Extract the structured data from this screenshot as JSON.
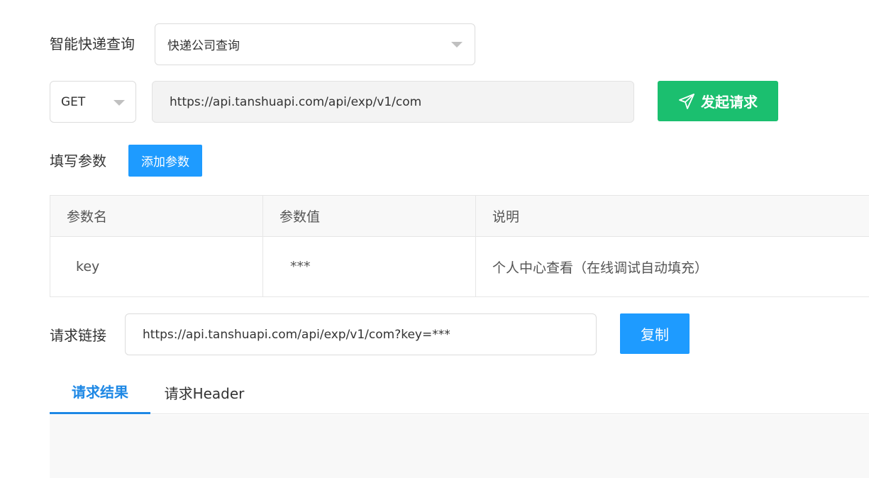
{
  "api": {
    "label": "智能快递查询",
    "selected": "快递公司查询"
  },
  "request": {
    "method": "GET",
    "url": "https://api.tanshuapi.com/api/exp/v1/com",
    "send_label": "发起请求"
  },
  "params": {
    "label": "填写参数",
    "add_label": "添加参数",
    "headers": [
      "参数名",
      "参数值",
      "说明"
    ],
    "rows": [
      {
        "name": "key",
        "value": "***",
        "desc": "个人中心查看（在线调试自动填充）"
      }
    ]
  },
  "link": {
    "label": "请求链接",
    "value": "https://api.tanshuapi.com/api/exp/v1/com?key=***",
    "copy_label": "复制"
  },
  "tabs": [
    {
      "label": "请求结果",
      "active": true
    },
    {
      "label": "请求Header",
      "active": false
    }
  ],
  "colors": {
    "send_button": "#1bbf6f",
    "primary_button": "#1e9bff",
    "active_tab": "#1e88e5"
  },
  "icons": {
    "send": "paper-plane-icon",
    "dropdown": "chevron-down-icon"
  }
}
